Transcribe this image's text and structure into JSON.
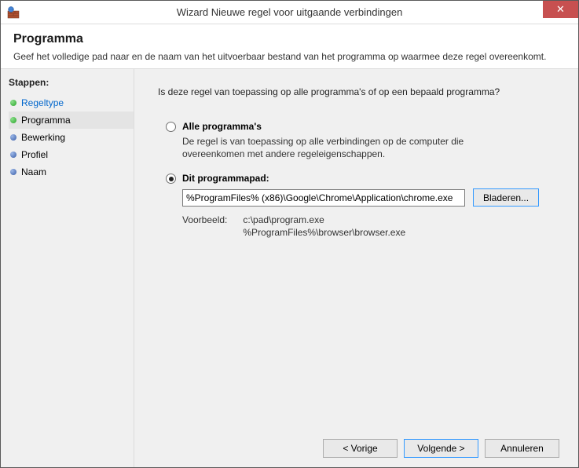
{
  "window": {
    "title": "Wizard Nieuwe regel voor uitgaande verbindingen"
  },
  "header": {
    "title": "Programma",
    "description": "Geef het volledige pad naar en de naam van het uitvoerbaar bestand van het programma op waarmee deze regel overeenkomt."
  },
  "sidebar": {
    "title": "Stappen:",
    "items": [
      {
        "label": "Regeltype"
      },
      {
        "label": "Programma"
      },
      {
        "label": "Bewerking"
      },
      {
        "label": "Profiel"
      },
      {
        "label": "Naam"
      }
    ]
  },
  "content": {
    "question": "Is deze regel van toepassing op alle programma's of op een bepaald programma?",
    "option_all": {
      "label": "Alle programma's",
      "desc": "De regel is van toepassing op alle verbindingen op de computer die overeenkomen met andere regeleigenschappen."
    },
    "option_path": {
      "label": "Dit programmapad:",
      "value": "%ProgramFiles% (x86)\\Google\\Chrome\\Application\\chrome.exe",
      "browse": "Bladeren...",
      "example_label": "Voorbeeld:",
      "example_paths": "c:\\pad\\program.exe\n%ProgramFiles%\\browser\\browser.exe"
    }
  },
  "footer": {
    "back": "< Vorige",
    "next": "Volgende >",
    "cancel": "Annuleren"
  }
}
